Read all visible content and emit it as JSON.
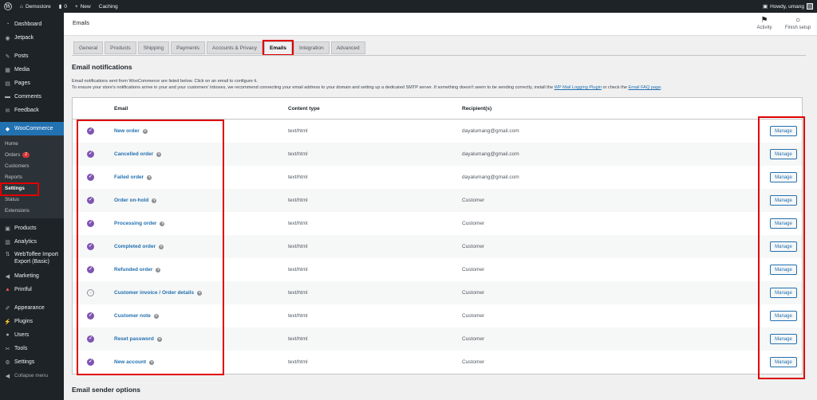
{
  "adminbar": {
    "site_name": "Demostore",
    "comments_count": "0",
    "new_label": "New",
    "caching_label": "Caching",
    "greeting": "Howdy, umang"
  },
  "sidebar": {
    "items_top": [
      {
        "label": "Dashboard",
        "icon": "dashboard-icon"
      },
      {
        "label": "Jetpack",
        "icon": "jetpack-icon"
      }
    ],
    "items_mid": [
      {
        "label": "Posts",
        "icon": "pin-icon"
      },
      {
        "label": "Media",
        "icon": "media-icon"
      },
      {
        "label": "Pages",
        "icon": "pages-icon"
      },
      {
        "label": "Comments",
        "icon": "comments-icon"
      },
      {
        "label": "Feedback",
        "icon": "feedback-icon"
      }
    ],
    "woocommerce_label": "WooCommerce",
    "submenu": [
      {
        "label": "Home"
      },
      {
        "label": "Orders",
        "badge": "2"
      },
      {
        "label": "Customers"
      },
      {
        "label": "Reports"
      },
      {
        "label": "Settings"
      },
      {
        "label": "Status"
      },
      {
        "label": "Extensions"
      }
    ],
    "items_bottom": [
      {
        "label": "Products",
        "icon": "products-icon"
      },
      {
        "label": "Analytics",
        "icon": "analytics-icon"
      },
      {
        "label": "WebToffee Import Export (Basic)",
        "icon": "webtoffee-icon"
      },
      {
        "label": "Marketing",
        "icon": "megaphone-icon"
      },
      {
        "label": "Printful",
        "icon": "printful-icon"
      }
    ],
    "items_last": [
      {
        "label": "Appearance",
        "icon": "brush-icon"
      },
      {
        "label": "Plugins",
        "icon": "plugin-icon"
      },
      {
        "label": "Users",
        "icon": "users-icon"
      },
      {
        "label": "Tools",
        "icon": "tools-icon"
      },
      {
        "label": "Settings",
        "icon": "settings-icon"
      },
      {
        "label": "Collapse menu",
        "icon": "collapse-icon"
      }
    ]
  },
  "header": {
    "title": "Emails",
    "activity_label": "Activity",
    "finish_setup_label": "Finish setup"
  },
  "tabs": [
    {
      "label": "General"
    },
    {
      "label": "Products"
    },
    {
      "label": "Shipping"
    },
    {
      "label": "Payments"
    },
    {
      "label": "Accounts & Privacy"
    },
    {
      "label": "Emails",
      "active": true
    },
    {
      "label": "Integration"
    },
    {
      "label": "Advanced"
    }
  ],
  "section_title": "Email notifications",
  "description": {
    "line1": "Email notifications sent from WooCommerce are listed below. Click on an email to configure it.",
    "line2_pre": "To ensure your store's notifications arrive in your and your customers' inboxes, we recommend connecting your email address to your domain and setting up a dedicated SMTP server. If something doesn't seem to be sending correctly, install the ",
    "link1": "WP Mail Logging Plugin",
    "line2_mid": " or check the ",
    "link2": "Email FAQ page",
    "line2_post": "."
  },
  "table": {
    "headers": {
      "email": "Email",
      "content_type": "Content type",
      "recipients": "Recipient(s)"
    },
    "manage_label": "Manage",
    "rows": [
      {
        "name": "New order",
        "type": "text/html",
        "recipient": "dayalumang@gmail.com",
        "status": "enabled"
      },
      {
        "name": "Cancelled order",
        "type": "text/html",
        "recipient": "dayalumang@gmail.com",
        "status": "enabled"
      },
      {
        "name": "Failed order",
        "type": "text/html",
        "recipient": "dayalumang@gmail.com",
        "status": "enabled"
      },
      {
        "name": "Order on-hold",
        "type": "text/html",
        "recipient": "Customer",
        "status": "enabled"
      },
      {
        "name": "Processing order",
        "type": "text/html",
        "recipient": "Customer",
        "status": "enabled"
      },
      {
        "name": "Completed order",
        "type": "text/html",
        "recipient": "Customer",
        "status": "enabled"
      },
      {
        "name": "Refunded order",
        "type": "text/html",
        "recipient": "Customer",
        "status": "enabled"
      },
      {
        "name": "Customer invoice / Order details",
        "type": "text/html",
        "recipient": "Customer",
        "status": "manual"
      },
      {
        "name": "Customer note",
        "type": "text/html",
        "recipient": "Customer",
        "status": "enabled"
      },
      {
        "name": "Reset password",
        "type": "text/html",
        "recipient": "Customer",
        "status": "enabled"
      },
      {
        "name": "New account",
        "type": "text/html",
        "recipient": "Customer",
        "status": "enabled"
      }
    ]
  },
  "sender_section_title": "Email sender options",
  "colors": {
    "sidebar_bg": "#1d2327",
    "active_menu": "#2271b1",
    "link": "#2271b1",
    "woo_purple": "#7f54b3",
    "highlight_red": "#e00000"
  }
}
